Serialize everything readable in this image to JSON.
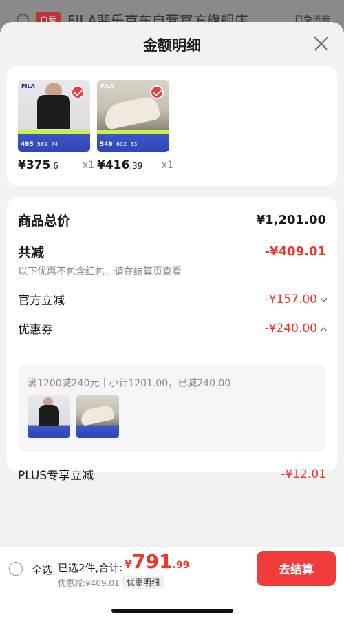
{
  "background": {
    "store_tag": "自营",
    "store_name": "FILA斐乐京东自营官方旗舰店",
    "right_text": "已免运费"
  },
  "sheet": {
    "title": "金额明细"
  },
  "products": [
    {
      "brand": "FILA",
      "price_int": "¥375",
      "price_dec": ".6",
      "qty": "x1",
      "band_price": "495",
      "band_sub": "569",
      "band_sub2": "74",
      "selected": true
    },
    {
      "brand": "FILA",
      "price_int": "¥416",
      "price_dec": ".39",
      "qty": "x1",
      "band_price": "549",
      "band_sub": "632",
      "band_sub2": "83",
      "selected": true
    }
  ],
  "detail": {
    "total_label": "商品总价",
    "total_value": "¥1,201.00",
    "reduce_label": "共减",
    "reduce_value": "-¥409.01",
    "note": "以下优惠不包含红包，请在结算页查看",
    "official_label": "官方立减",
    "official_value": "-¥157.00",
    "coupon_label": "优惠券",
    "coupon_value": "-¥240.00",
    "coupon_desc": "满1200减240元｜小计1201.00，已减240.00",
    "plus_label": "PLUS专享立减",
    "plus_value": "-¥12.01"
  },
  "bottom": {
    "select_all": "全选",
    "selected_text": "已选2件,合计:",
    "total_cur": "¥",
    "total_int": "791",
    "total_dec": ".99",
    "discount_text": "优惠减:¥409.01",
    "detail_chip": "优惠明细",
    "checkout": "去结算"
  },
  "colors": {
    "accent": "#f23c3c",
    "price_red": "#f0362a"
  }
}
